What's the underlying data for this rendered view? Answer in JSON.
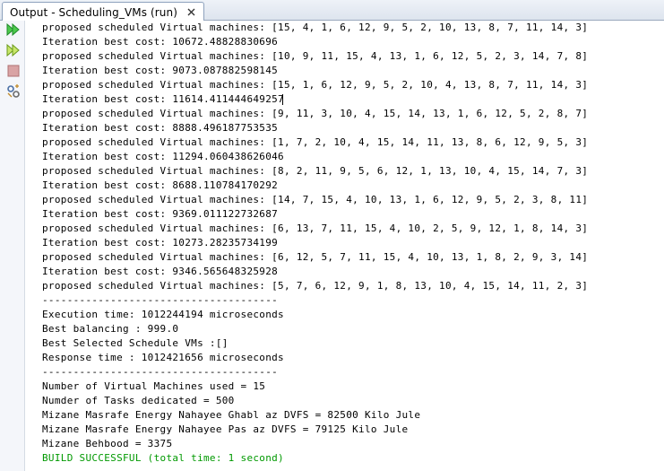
{
  "tab": {
    "title": "Output - Scheduling_VMs (run)",
    "close_icon": "close-icon"
  },
  "toolbar": {
    "buttons": [
      {
        "icon": "rerun-icon",
        "label": "Re-run"
      },
      {
        "icon": "rerun-with-params-icon",
        "label": "Re-run with parameters"
      },
      {
        "icon": "stop-icon",
        "label": "Stop"
      },
      {
        "icon": "settings-icon",
        "label": "Settings"
      }
    ]
  },
  "colors": {
    "success_text": "#009900",
    "run_icon": "#2faa3a",
    "stop_icon": "#c9898a"
  },
  "output": {
    "lines": [
      "proposed scheduled Virtual machines: [15, 4, 1, 6, 12, 9, 5, 2, 10, 13, 8, 7, 11, 14, 3]",
      "Iteration best cost: 10672.48828830696",
      "proposed scheduled Virtual machines: [10, 9, 11, 15, 4, 13, 1, 6, 12, 5, 2, 3, 14, 7, 8]",
      "Iteration best cost: 9073.087882598145",
      "proposed scheduled Virtual machines: [15, 1, 6, 12, 9, 5, 2, 10, 4, 13, 8, 7, 11, 14, 3]",
      "Iteration best cost: 11614.411444649257",
      "proposed scheduled Virtual machines: [9, 11, 3, 10, 4, 15, 14, 13, 1, 6, 12, 5, 2, 8, 7]",
      "Iteration best cost: 8888.496187753535",
      "proposed scheduled Virtual machines: [1, 7, 2, 10, 4, 15, 14, 11, 13, 8, 6, 12, 9, 5, 3]",
      "Iteration best cost: 11294.060438626046",
      "proposed scheduled Virtual machines: [8, 2, 11, 9, 5, 6, 12, 1, 13, 10, 4, 15, 14, 7, 3]",
      "Iteration best cost: 8688.110784170292",
      "proposed scheduled Virtual machines: [14, 7, 15, 4, 10, 13, 1, 6, 12, 9, 5, 2, 3, 8, 11]",
      "Iteration best cost: 9369.011122732687",
      "proposed scheduled Virtual machines: [6, 13, 7, 11, 15, 4, 10, 2, 5, 9, 12, 1, 8, 14, 3]",
      "Iteration best cost: 10273.28235734199",
      "proposed scheduled Virtual machines: [6, 12, 5, 7, 11, 15, 4, 10, 13, 1, 8, 2, 9, 3, 14]",
      "Iteration best cost: 9346.565648325928",
      "proposed scheduled Virtual machines: [5, 7, 6, 12, 9, 1, 8, 13, 10, 4, 15, 14, 11, 2, 3]",
      "--------------------------------------",
      "Execution time: 1012244194 microseconds",
      "Best balancing : 999.0",
      "Best Selected Schedule VMs :[]",
      "Response time : 1012421656 microseconds",
      "--------------------------------------",
      "Number of Virtual Machines used = 15",
      "Numder of Tasks dedicated = 500",
      "Mizane Masrafe Energy Nahayee Ghabl az DVFS = 82500 Kilo Jule",
      "Mizane Masrafe Energy Nahayee Pas az DVFS = 79125 Kilo Jule",
      "Mizane Behbood = 3375",
      "BUILD SUCCESSFUL (total time: 1 second)"
    ]
  }
}
